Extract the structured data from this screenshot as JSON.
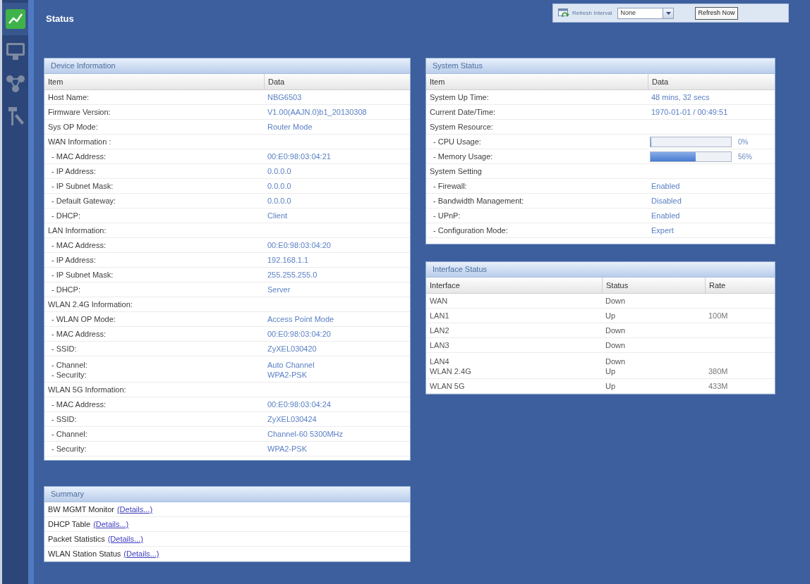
{
  "sidebar": {
    "items": [
      {
        "selected": true
      },
      {
        "selected": false
      },
      {
        "selected": false
      },
      {
        "selected": false
      }
    ]
  },
  "header": {
    "title": "Status"
  },
  "refresh": {
    "label": "Refresh Interval",
    "interval": "None",
    "button": "Refresh Now"
  },
  "device_information": {
    "title": "Device Information",
    "columns": [
      "Item",
      "Data"
    ],
    "rows": [
      {
        "kind": "field",
        "item": "Host Name:",
        "data": "NBG6503"
      },
      {
        "kind": "field",
        "item": "Firmware Version:",
        "data": "V1.00(AAJN.0)b1_20130308"
      },
      {
        "kind": "field",
        "item": "Sys OP Mode:",
        "data": "Router Mode"
      },
      {
        "kind": "group",
        "item": "WAN Information :",
        "children": [
          {
            "kind": "field",
            "item": "- MAC Address:",
            "data": "00:E0:98:03:04:21"
          },
          {
            "kind": "field",
            "item": "- IP Address:",
            "data": "0.0.0.0"
          },
          {
            "kind": "field",
            "item": "- IP Subnet Mask:",
            "data": "0.0.0.0"
          },
          {
            "kind": "field",
            "item": "- Default Gateway:",
            "data": "0.0.0.0"
          },
          {
            "kind": "field",
            "item": "- DHCP:",
            "data": "Client"
          }
        ]
      },
      {
        "kind": "group",
        "item": "LAN Information:",
        "children": [
          {
            "kind": "field",
            "item": "- MAC Address:",
            "data": "00:E0:98:03:04:20"
          },
          {
            "kind": "field",
            "item": "- IP Address:",
            "data": "192.168.1.1"
          },
          {
            "kind": "field",
            "item": "- IP Subnet Mask:",
            "data": "255.255.255.0"
          },
          {
            "kind": "field",
            "item": "- DHCP:",
            "data": "Server"
          }
        ]
      },
      {
        "kind": "group",
        "item": "WLAN 2.4G Information:",
        "children": [
          {
            "kind": "field",
            "item": "- WLAN OP Mode:",
            "data": "Access Point Mode"
          },
          {
            "kind": "field",
            "item": "- MAC Address:",
            "data": "00:E0:98:03:04:20"
          },
          {
            "kind": "field",
            "item": "- SSID:",
            "data": "ZyXEL030420"
          },
          {
            "kind": "stacked",
            "lines": [
              {
                "item": "- Channel:",
                "data": "Auto Channel"
              },
              {
                "item": "- Security:",
                "data": "WPA2-PSK"
              }
            ]
          }
        ]
      },
      {
        "kind": "group",
        "item": "WLAN 5G Information:",
        "children": [
          {
            "kind": "field",
            "item": "- MAC Address:",
            "data": "00:E0:98:03:04:24"
          },
          {
            "kind": "field",
            "item": "- SSID:",
            "data": "ZyXEL030424"
          },
          {
            "kind": "field",
            "item": "- Channel:",
            "data": "Channel-60 5300MHz"
          },
          {
            "kind": "field",
            "item": "- Security:",
            "data": "WPA2-PSK"
          }
        ]
      }
    ]
  },
  "summary": {
    "title": "Summary",
    "items": [
      {
        "label": "BW MGMT Monitor",
        "link": "(Details...)"
      },
      {
        "label": "DHCP Table",
        "link": "(Details...)"
      },
      {
        "label": "Packet Statistics",
        "link": "(Details...)"
      },
      {
        "label": "WLAN Station Status",
        "link": "(Details...)"
      }
    ]
  },
  "system_status": {
    "title": "System Status",
    "columns": [
      "Item",
      "Data"
    ],
    "rows": [
      {
        "kind": "field",
        "item": "System Up Time:",
        "data": "48 mins, 32 secs"
      },
      {
        "kind": "field",
        "item": "Current Date/Time:",
        "data": "1970-01-01 / 00:49:51"
      },
      {
        "kind": "group",
        "item": "System Resource:",
        "children": [
          {
            "kind": "meter",
            "item": "- CPU Usage:",
            "level": 0,
            "reading": "0%"
          },
          {
            "kind": "meter",
            "item": "- Memory Usage:",
            "level": 0.56,
            "reading": "56%"
          }
        ]
      },
      {
        "kind": "group",
        "item": "System Setting",
        "children": [
          {
            "kind": "field",
            "item": "- Firewall:",
            "data": "Enabled"
          },
          {
            "kind": "field",
            "item": "- Bandwidth Management:",
            "data": "Disabled"
          },
          {
            "kind": "field",
            "item": "- UPnP:",
            "data": "Enabled"
          },
          {
            "kind": "field",
            "item": "- Configuration Mode:",
            "data": "Expert"
          }
        ]
      }
    ]
  },
  "interface_status": {
    "title": "Interface Status",
    "columns": [
      "Interface",
      "Status",
      "Rate"
    ],
    "rows": [
      {
        "kind": "row",
        "interface": "WAN",
        "status": "Down"
      },
      {
        "kind": "row",
        "interface": "LAN1",
        "status": "Up",
        "rate": "100M"
      },
      {
        "kind": "row",
        "interface": "LAN2",
        "status": "Down"
      },
      {
        "kind": "row",
        "interface": "LAN3",
        "status": "Down"
      },
      {
        "kind": "stacked",
        "lines": [
          {
            "interface": "LAN4",
            "status": "Down"
          },
          {
            "interface": "WLAN 2.4G",
            "status": "Up",
            "rate": "380M"
          }
        ]
      },
      {
        "kind": "row",
        "interface": "WLAN 5G",
        "status": "Up",
        "rate": "433M"
      }
    ]
  }
}
